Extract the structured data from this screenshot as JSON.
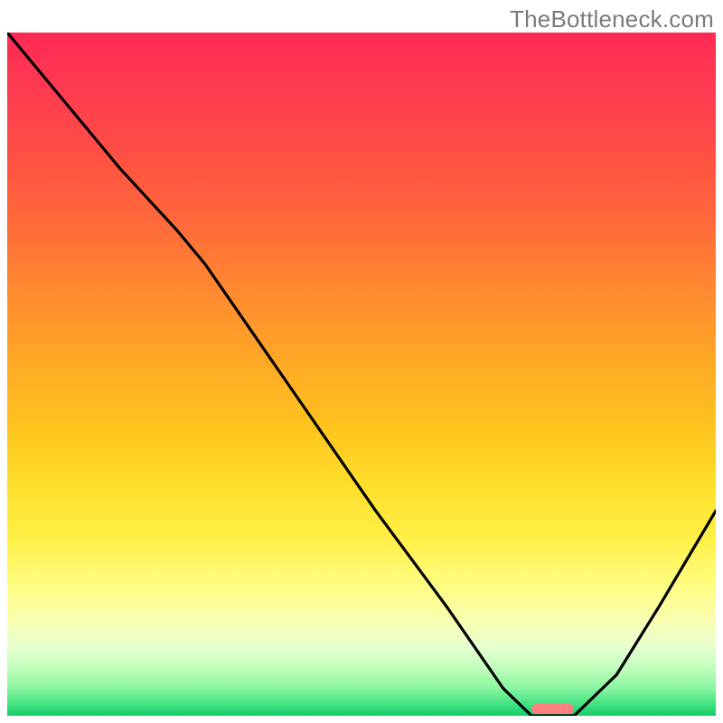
{
  "watermark": "TheBottleneck.com",
  "colors": {
    "gradient_top": "#ff2a55",
    "gradient_bottom": "#18cc6a",
    "curve": "#000000",
    "marker": "#ff7f7f"
  },
  "chart_data": {
    "type": "line",
    "title": "",
    "xlabel": "",
    "ylabel": "",
    "xlim": [
      0,
      100
    ],
    "ylim": [
      0,
      100
    ],
    "x": [
      0,
      8,
      16,
      24,
      28,
      40,
      52,
      62,
      70,
      74,
      80,
      86,
      92,
      100
    ],
    "values": [
      100,
      90,
      80,
      71,
      66,
      48,
      30,
      16,
      4,
      0,
      0,
      6,
      16,
      30
    ],
    "marker_x_range": [
      74,
      80
    ],
    "annotations": []
  }
}
